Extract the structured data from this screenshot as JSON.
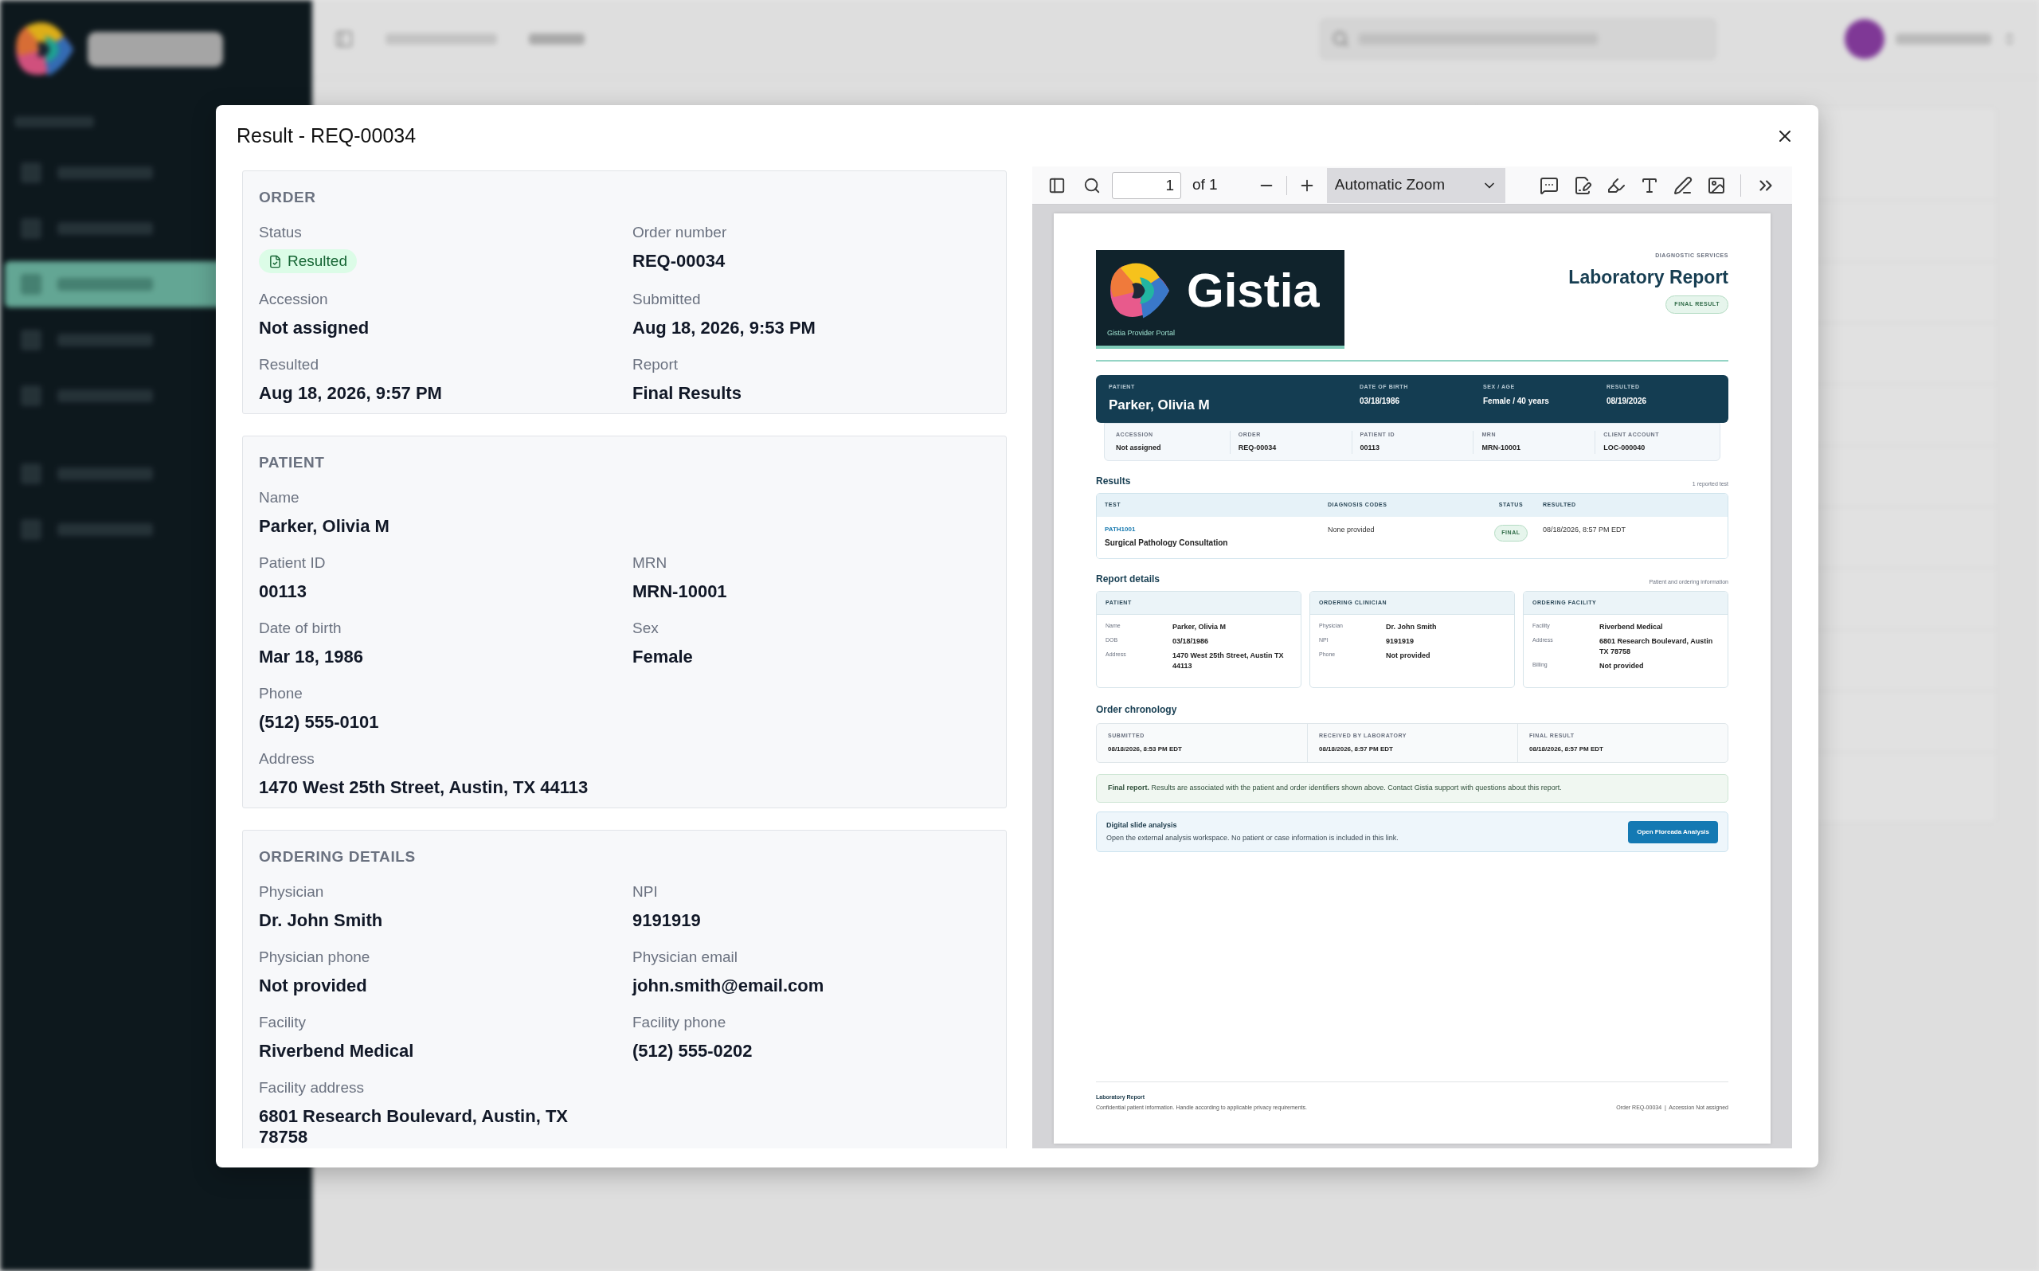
{
  "background": {
    "sidebar_items": [
      {
        "selected": false
      },
      {
        "selected": false
      },
      {
        "selected": true
      },
      {
        "selected": false
      },
      {
        "selected": false
      }
    ]
  },
  "dialog": {
    "title": "Result - REQ-00034",
    "sections": [
      {
        "title": "ORDER",
        "rows": [
          [
            {
              "label": "Status",
              "value": "Resulted",
              "kind": "badge"
            },
            {
              "label": "Order number",
              "value": "REQ-00034",
              "kind": "text"
            }
          ],
          [
            {
              "label": "Accession",
              "value": "Not assigned",
              "kind": "text"
            },
            {
              "label": "Submitted",
              "value": "Aug 18, 2026, 9:53 PM",
              "kind": "text"
            }
          ],
          [
            {
              "label": "Resulted",
              "value": "Aug 18, 2026, 9:57 PM",
              "kind": "text"
            },
            {
              "label": "Report",
              "value": "Final Results",
              "kind": "text"
            }
          ]
        ]
      },
      {
        "title": "PATIENT",
        "rows": [
          [
            {
              "label": "Name",
              "value": "Parker, Olivia M",
              "kind": "text"
            }
          ],
          [
            {
              "label": "Patient ID",
              "value": "00113",
              "kind": "text"
            },
            {
              "label": "MRN",
              "value": "MRN-10001",
              "kind": "text"
            }
          ],
          [
            {
              "label": "Date of birth",
              "value": "Mar 18, 1986",
              "kind": "text"
            },
            {
              "label": "Sex",
              "value": "Female",
              "kind": "text"
            }
          ],
          [
            {
              "label": "Phone",
              "value": "(512) 555-0101",
              "kind": "text"
            }
          ],
          [
            {
              "label": "Address",
              "value": "1470 West 25th Street, Austin, TX 44113",
              "kind": "text"
            }
          ]
        ]
      },
      {
        "title": "ORDERING DETAILS",
        "rows": [
          [
            {
              "label": "Physician",
              "value": "Dr. John Smith",
              "kind": "text"
            },
            {
              "label": "NPI",
              "value": "9191919",
              "kind": "text"
            }
          ],
          [
            {
              "label": "Physician phone",
              "value": "Not provided",
              "kind": "text"
            },
            {
              "label": "Physician email",
              "value": "john.smith@email.com",
              "kind": "text"
            }
          ],
          [
            {
              "label": "Facility",
              "value": "Riverbend Medical",
              "kind": "text"
            },
            {
              "label": "Facility phone",
              "value": "(512) 555-0202",
              "kind": "text"
            }
          ],
          [
            {
              "label": "Facility address",
              "value": "6801 Research Boulevard, Austin, TX 78758",
              "kind": "text"
            }
          ]
        ]
      }
    ]
  },
  "viewer": {
    "page_input": "1",
    "page_count": "of 1",
    "zoom": "Automatic Zoom"
  },
  "report": {
    "brand": "Gistia",
    "brand_caption": "Gistia Provider Portal",
    "eyebrow": "DIAGNOSTIC SERVICES",
    "title": "Laboratory Report",
    "badge": "FINAL RESULT",
    "banner": [
      {
        "label": "PATIENT",
        "value": "Parker, Olivia M"
      },
      {
        "label": "DATE OF BIRTH",
        "value": "03/18/1986"
      },
      {
        "label": "SEX / AGE",
        "value": "Female / 40 years"
      },
      {
        "label": "RESULTED",
        "value": "08/19/2026"
      }
    ],
    "identifiers": [
      {
        "label": "ACCESSION",
        "value": "Not assigned"
      },
      {
        "label": "ORDER",
        "value": "REQ-00034"
      },
      {
        "label": "PATIENT ID",
        "value": "00113"
      },
      {
        "label": "MRN",
        "value": "MRN-10001"
      },
      {
        "label": "CLIENT ACCOUNT",
        "value": "LOC-000040"
      }
    ],
    "results": {
      "heading": "Results",
      "note": "1 reported test",
      "columns": [
        "TEST",
        "DIAGNOSIS CODES",
        "STATUS",
        "RESULTED"
      ],
      "rows": [
        {
          "code": "PATH1001",
          "name": "Surgical Pathology Consultation",
          "diagnosis": "None provided",
          "status": "FINAL",
          "resulted": "08/18/2026, 8:57 PM EDT"
        }
      ]
    },
    "details": {
      "heading": "Report details",
      "note": "Patient and ordering information",
      "cards": [
        {
          "title": "PATIENT",
          "fields": [
            {
              "label": "Name",
              "value": "Parker, Olivia M"
            },
            {
              "label": "DOB",
              "value": "03/18/1986"
            },
            {
              "label": "Address",
              "value": "1470 West 25th Street, Austin TX 44113"
            }
          ]
        },
        {
          "title": "ORDERING CLINICIAN",
          "fields": [
            {
              "label": "Physician",
              "value": "Dr. John Smith"
            },
            {
              "label": "NPI",
              "value": "9191919"
            },
            {
              "label": "Phone",
              "value": "Not provided"
            }
          ]
        },
        {
          "title": "ORDERING FACILITY",
          "fields": [
            {
              "label": "Facility",
              "value": "Riverbend Medical"
            },
            {
              "label": "Address",
              "value": "6801 Research Boulevard, Austin TX 78758"
            },
            {
              "label": "Billing",
              "value": "Not provided"
            }
          ]
        }
      ]
    },
    "chronology": {
      "heading": "Order chronology",
      "steps": [
        {
          "label": "SUBMITTED",
          "value": "08/18/2026, 8:53 PM EDT"
        },
        {
          "label": "RECEIVED BY LABORATORY",
          "value": "08/18/2026, 8:57 PM EDT"
        },
        {
          "label": "FINAL RESULT",
          "value": "08/18/2026, 8:57 PM EDT"
        }
      ]
    },
    "notice": "**Final report.** Results are associated with the patient and order identifiers shown above. Contact Gistia support with questions about this report.",
    "slide": {
      "title": "Digital slide analysis",
      "text": "Open the external analysis workspace. No patient or case information is included in this link.",
      "button": "Open Floreada Analysis"
    },
    "footer": {
      "title": "Laboratory Report",
      "text": "Confidential patient information. Handle according to applicable privacy requirements.",
      "right": "Order REQ-00034  |  Accession Not assigned"
    }
  }
}
